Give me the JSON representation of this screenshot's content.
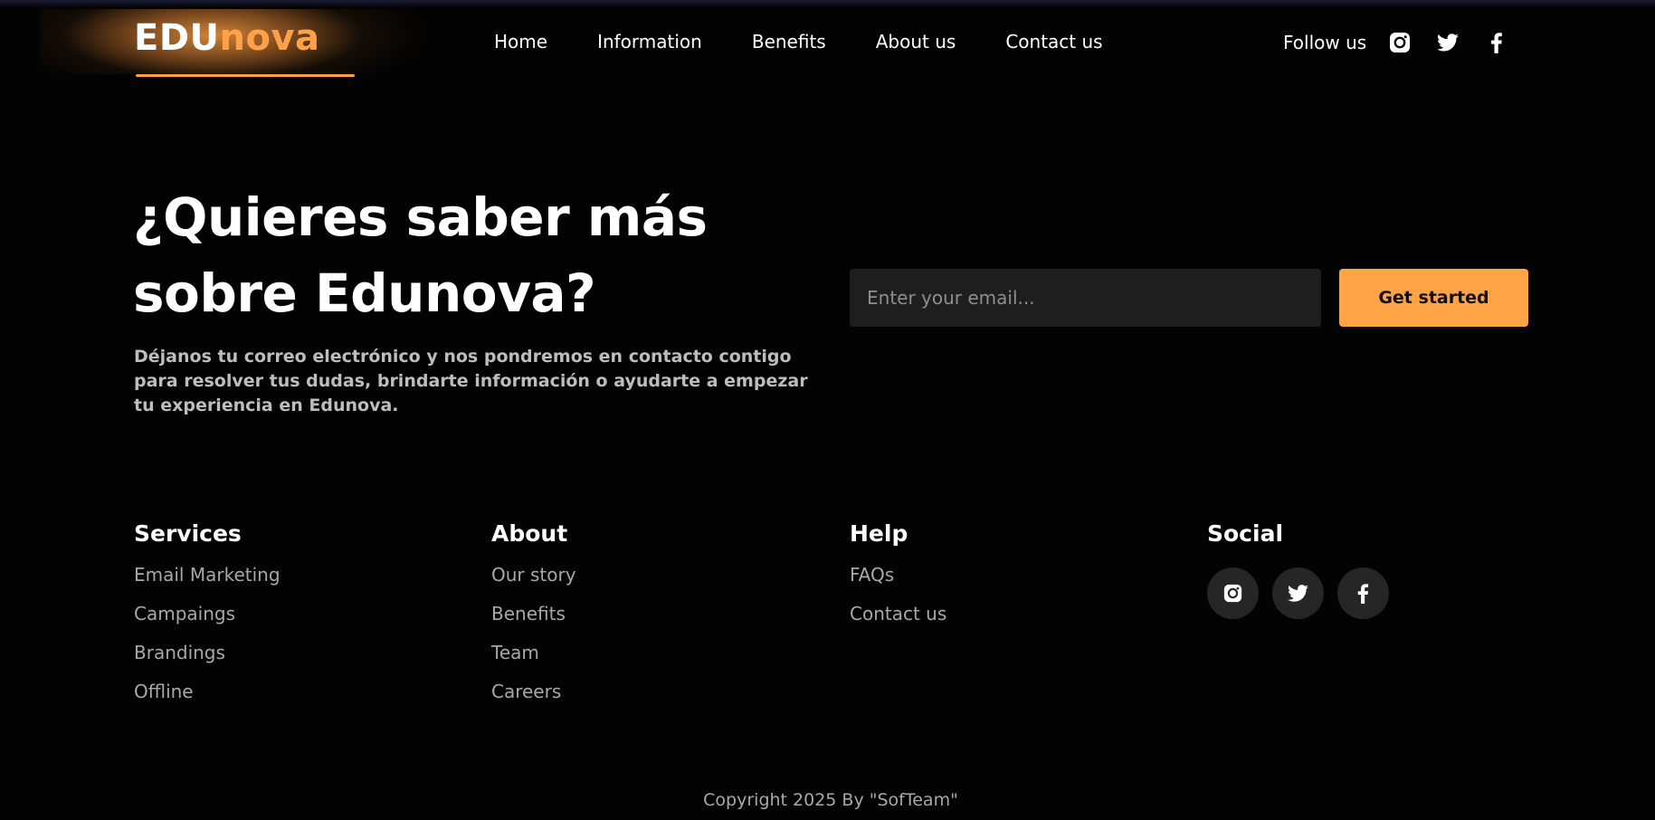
{
  "colors": {
    "background": "#030303",
    "accent": "#ffa347",
    "input_background": "#1e1e1e",
    "muted_text": "#a8a8a8"
  },
  "navbar": {
    "logo": {
      "part1": "EDU",
      "part2": "nova"
    },
    "links": [
      "Home",
      "Information",
      "Benefits",
      "About us",
      "Contact us"
    ],
    "follow_label": "Follow us",
    "social_icons": [
      "instagram-icon",
      "twitter-icon",
      "facebook-icon"
    ]
  },
  "hero": {
    "title_line1": "¿Quieres saber más",
    "title_line2": "sobre Edunova?",
    "description": "Déjanos tu correo electrónico y nos pondremos en contacto contigo para resolver tus dudas, brindarte información o ayudarte a empezar tu experiencia en Edunova.",
    "email_placeholder": "Enter your email...",
    "email_value": "",
    "cta_label": "Get started"
  },
  "footer": {
    "services": {
      "heading": "Services",
      "links": [
        "Email Marketing",
        "Campaings",
        "Brandings",
        "Offline"
      ]
    },
    "about": {
      "heading": "About",
      "links": [
        "Our story",
        "Benefits",
        "Team",
        "Careers"
      ]
    },
    "help": {
      "heading": "Help",
      "links": [
        "FAQs",
        "Contact us"
      ]
    },
    "social": {
      "heading": "Social",
      "icons": [
        "instagram-icon",
        "twitter-icon",
        "facebook-icon"
      ]
    },
    "copyright": "Copyright 2025 By \"SofTeam\""
  }
}
